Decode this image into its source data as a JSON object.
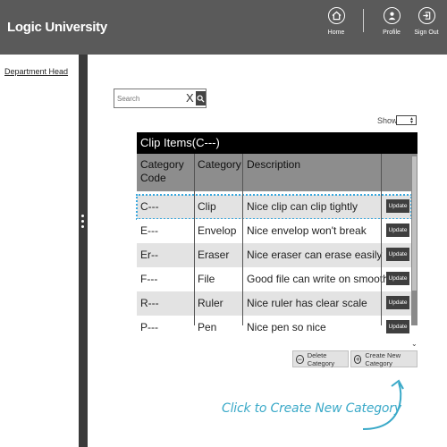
{
  "header": {
    "brand": "Logic University",
    "nav": [
      {
        "label": "Home",
        "icon": "home-icon"
      },
      {
        "label": "Profile",
        "icon": "profile-icon"
      },
      {
        "label": "Sign Out",
        "icon": "sign-out-icon"
      }
    ]
  },
  "sidebar": {
    "link": "Department Head"
  },
  "search": {
    "placeholder": "Search",
    "clear": "X"
  },
  "show": {
    "label": "Show"
  },
  "table": {
    "title": "Clip Items(C---)",
    "headers": [
      "Category Code",
      "Category",
      "Description"
    ],
    "rows": [
      {
        "code": "C---",
        "category": "Clip",
        "description": "Nice clip can clip tightly",
        "action": "Update"
      },
      {
        "code": "E---",
        "category": "Envelop",
        "description": "Nice envelop won't break",
        "action": "Update"
      },
      {
        "code": "Er--",
        "category": "Eraser",
        "description": "Nice eraser can erase easily",
        "action": "Update"
      },
      {
        "code": "F---",
        "category": "File",
        "description": "Good file can write on smoothly",
        "action": "Update"
      },
      {
        "code": "R---",
        "category": "Ruler",
        "description": "Nice ruler has clear scale",
        "action": "Update"
      },
      {
        "code": "P---",
        "category": "Pen",
        "description": "Nice pen so nice",
        "action": "Update"
      }
    ]
  },
  "actions": {
    "delete": "Delete Category",
    "create": "Create New Category"
  },
  "annotation": "Click to Create New Category",
  "colors": {
    "header": "#5a5a5a",
    "sidebar_bar": "#3a3a3a",
    "row_alt": "#e3e3e3",
    "highlight": "#39a8de",
    "annotation": "#3aa9c8"
  }
}
